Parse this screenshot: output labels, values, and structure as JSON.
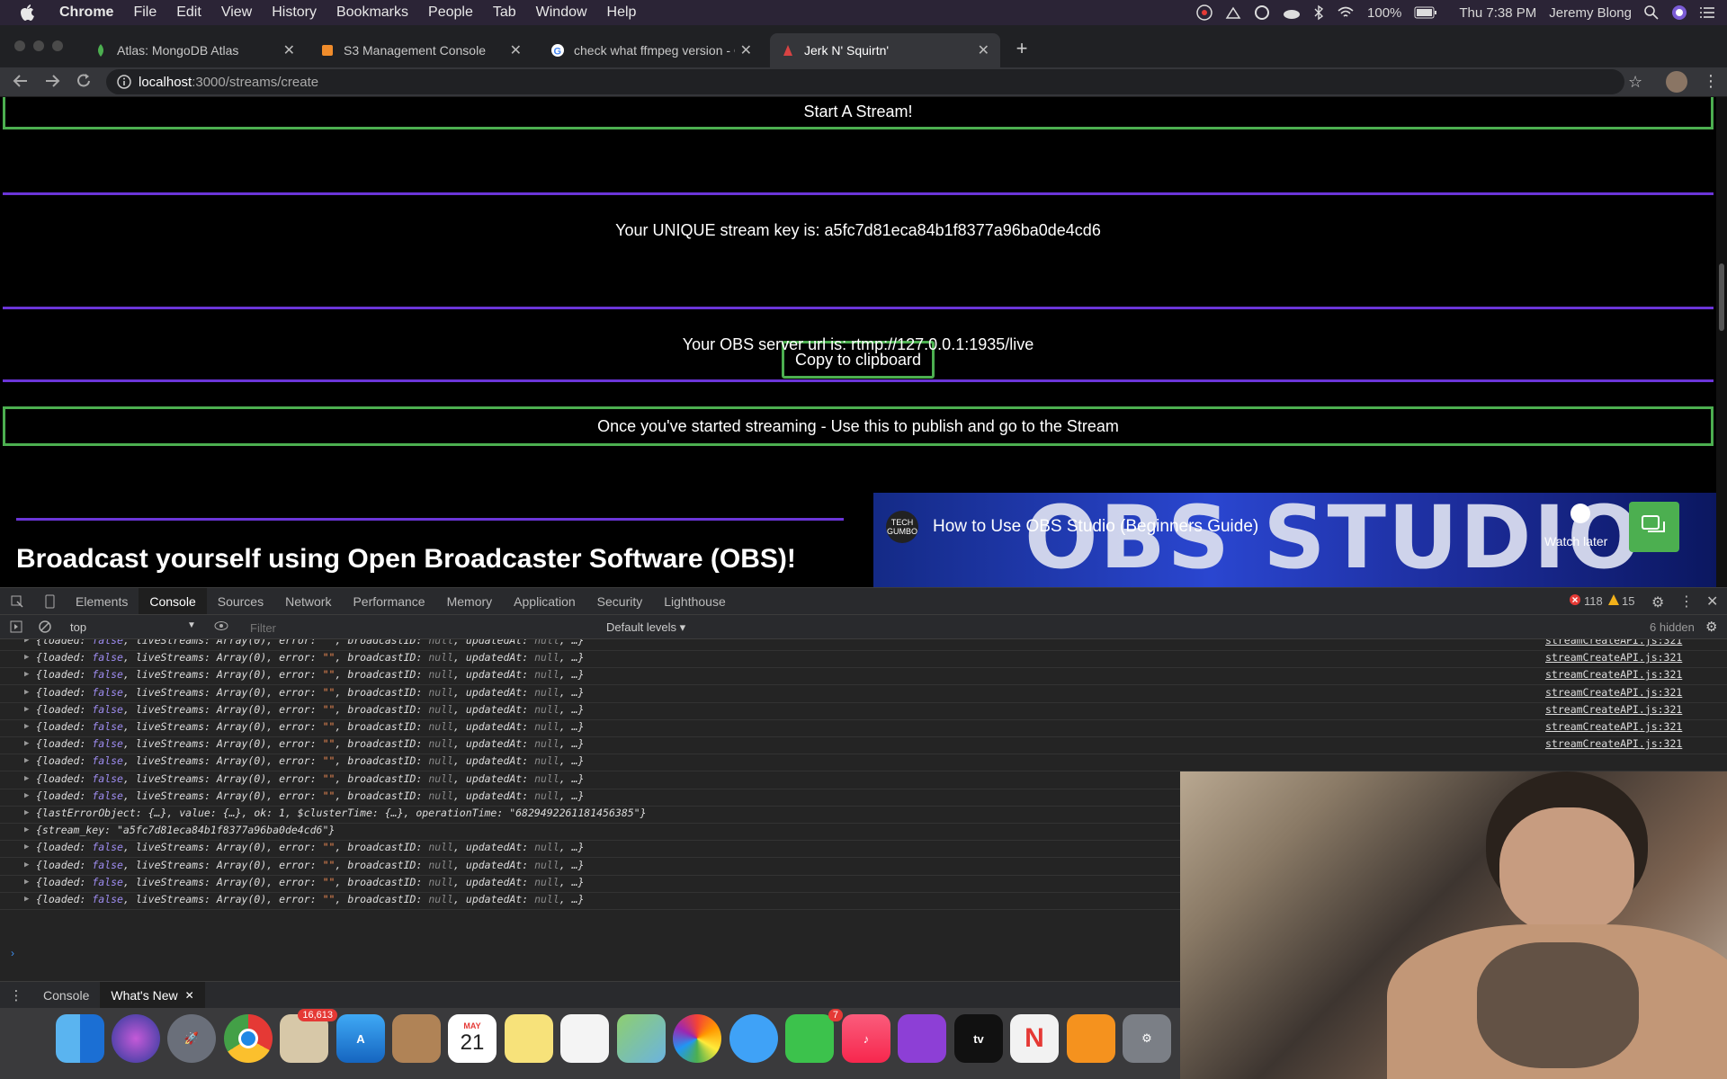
{
  "menubar": {
    "app": "Chrome",
    "items": [
      "File",
      "Edit",
      "View",
      "History",
      "Bookmarks",
      "People",
      "Tab",
      "Window",
      "Help"
    ],
    "battery": "100%",
    "clock": "Thu 7:38 PM",
    "user": "Jeremy Blong"
  },
  "tabs": [
    {
      "title": "Atlas: MongoDB Atlas",
      "icon": "mongodb-leaf-icon"
    },
    {
      "title": "S3 Management Console",
      "icon": "aws-cube-icon"
    },
    {
      "title": "check what ffmpeg version - G",
      "icon": "google-icon"
    },
    {
      "title": "Jerk N' Squirtn'",
      "icon": "site-icon"
    }
  ],
  "omnibox": {
    "host": "localhost",
    "path": ":3000/streams/create"
  },
  "page": {
    "start_stream": "Start A Stream!",
    "stream_key_text": "Your UNIQUE stream key is: a5fc7d81eca84b1f8377a96ba0de4cd6",
    "copy_button": "Copy to clipboard",
    "obs_url_text": "Your OBS server url is: rtmp://127.0.0.1:1935/live",
    "publish_text": "Once you've started streaming - Use this to publish and go to the Stream",
    "obs_heading": "Broadcast yourself using Open Broadcaster Software (OBS)!",
    "video_title": "How to Use OBS Studio (Beginners Guide)",
    "video_banner": "OBS STUDIO",
    "video_channel": "TECH GUMBO",
    "watch_later": "Watch later"
  },
  "devtools": {
    "tabs": [
      "Elements",
      "Console",
      "Sources",
      "Network",
      "Performance",
      "Memory",
      "Application",
      "Security",
      "Lighthouse"
    ],
    "active_tab": "Console",
    "errors": "118",
    "warnings": "15",
    "context": "top",
    "filter_placeholder": "Filter",
    "levels": "Default levels",
    "hidden": "6 hidden",
    "source": "streamCreateAPI.js:321",
    "lastError_row": "{lastErrorObject: {…}, value: {…}, ok: 1, $clusterTime: {…}, operationTime: \"6829492261181456385\"}",
    "stream_key_row": "{stream_key: \"a5fc7d81eca84b1f8377a96ba0de4cd6\"}",
    "bottom_tabs": [
      "Console",
      "What's New"
    ]
  },
  "dock": {
    "mail_badge": "16,613",
    "calendar_month": "MAY",
    "calendar_day": "21",
    "facetime_badge": "7"
  },
  "colors": {
    "green": "#4caf50",
    "purple": "#6b35d8"
  }
}
